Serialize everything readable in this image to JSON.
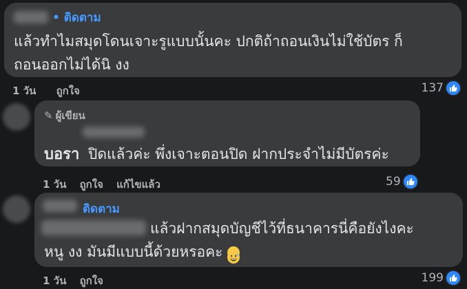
{
  "comments": [
    {
      "badge": "• ติดตาม",
      "lines": [
        "แล้วทำไมสมุดโดนเจาะรูแบบนั้นคะ ปกติถ้าถอนเงินไม่ใช้บัตร ก็",
        "ถอนออกไม่ได้นิ งง"
      ],
      "time": "1 วัน",
      "like_label": "ถูกใจ",
      "likes": "137"
    },
    {
      "author_tag": "ผู้เขียน",
      "name": "บอรา",
      "text": "ปิดแล้วค่ะ พึ่งเจาะตอนปิด ฝากประจำไม่มีบัตรค่ะ",
      "time": "1 วัน",
      "like_label": "ถูกใจ",
      "edited_label": "แก้ไขแล้ว",
      "likes": "59"
    },
    {
      "badge": "ติดตาม",
      "line1": "แล้วฝากสมุดบัญชีไว้ที่ธนาคารนี่คือยังไงคะ",
      "line2": "หนู งง มันมีแบบนี้ด้วยหรอคะ",
      "emoji": "grinning-sweat-emoji",
      "time": "1 วัน",
      "like_label": "ถูกใจ",
      "likes": "199"
    }
  ],
  "colors": {
    "background": "#18191a",
    "bubble": "#3a3b3c",
    "follow": "#4599ff",
    "like": "#2d88ff"
  }
}
